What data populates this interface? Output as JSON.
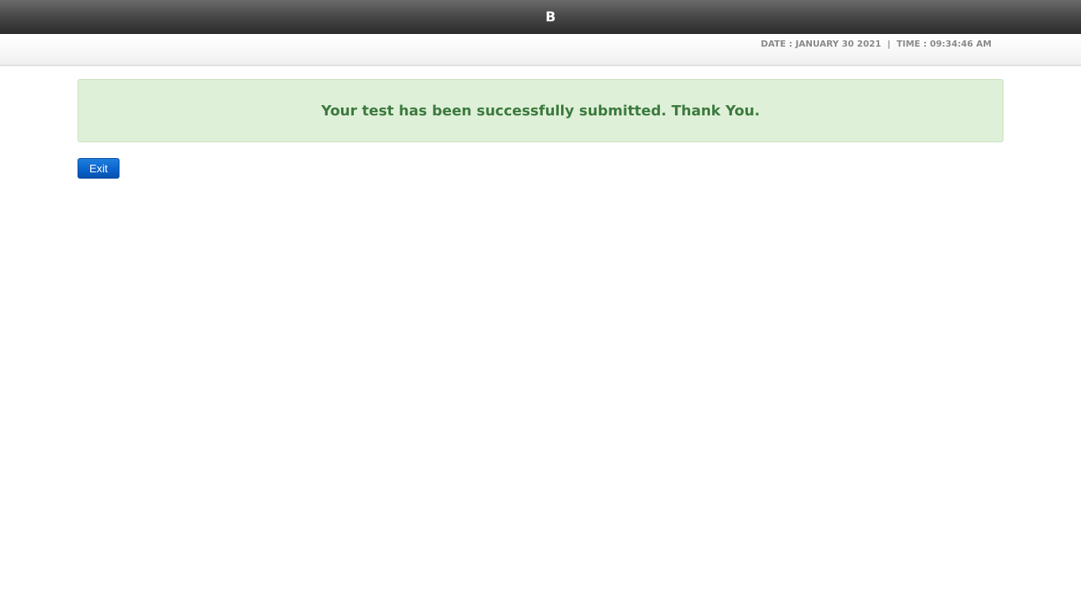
{
  "header": {
    "title": "B"
  },
  "subheader": {
    "datetime": "DATE : JANUARY 30 2021  |  TIME : 09:34:46 AM"
  },
  "main": {
    "success_message": "Your test has been successfully submitted. Thank You.",
    "exit_label": "Exit"
  },
  "colors": {
    "alert_background": "#dff0d8",
    "alert_text": "#3c7a3e",
    "button_blue": "#0a64cc",
    "topbar_dark": "#2c2c2c"
  }
}
